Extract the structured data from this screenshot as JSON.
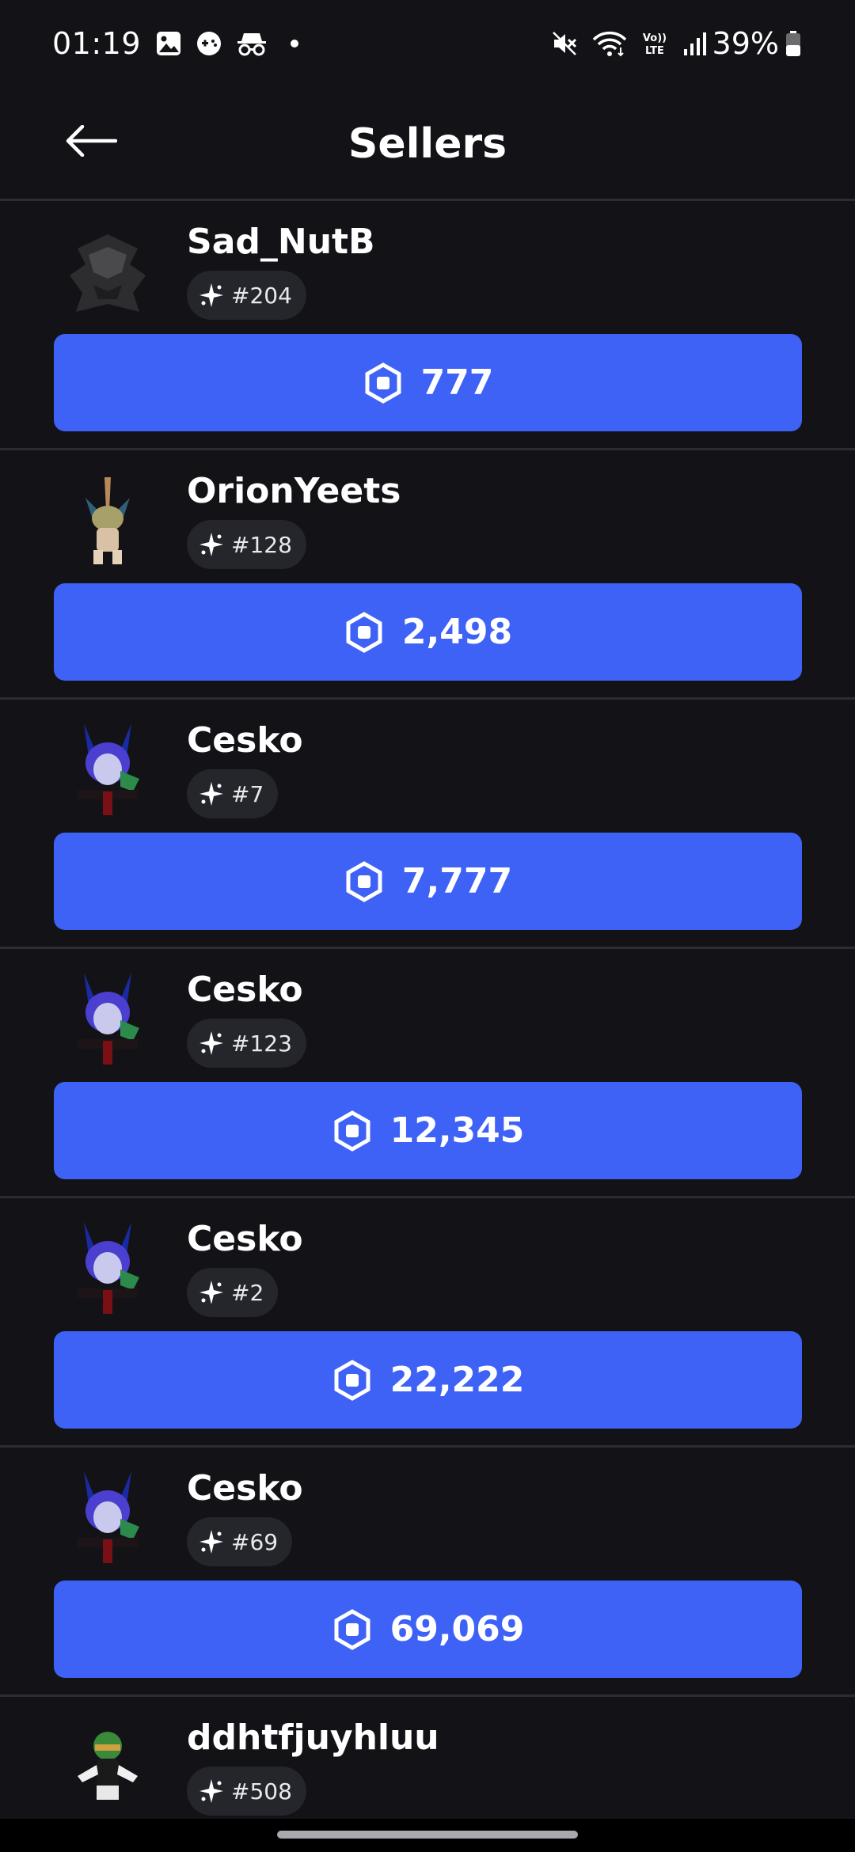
{
  "status_bar": {
    "time": "01:19",
    "battery": "39%",
    "left_icons": [
      "gallery-icon",
      "game-controller-icon",
      "incognito-icon",
      "dot-icon"
    ],
    "right_icons": [
      "mute-icon",
      "wifi-icon",
      "volte-icon",
      "signal-icon",
      "battery-icon"
    ]
  },
  "header": {
    "title": "Sellers",
    "back_icon": "arrow-left-icon"
  },
  "sellers": [
    {
      "name": "Sad_NutB",
      "rank": "#204",
      "price": "777"
    },
    {
      "name": "OrionYeets",
      "rank": "#128",
      "price": "2,498"
    },
    {
      "name": "Cesko",
      "rank": "#7",
      "price": "7,777"
    },
    {
      "name": "Cesko",
      "rank": "#123",
      "price": "12,345"
    },
    {
      "name": "Cesko",
      "rank": "#2",
      "price": "22,222"
    },
    {
      "name": "Cesko",
      "rank": "#69",
      "price": "69,069"
    },
    {
      "name": "ddhtfjuyhluu",
      "rank": "#508"
    }
  ],
  "colors": {
    "background": "#131317",
    "accent": "#3e62f6",
    "divider": "#2c2d33",
    "badge": "#25262c"
  }
}
